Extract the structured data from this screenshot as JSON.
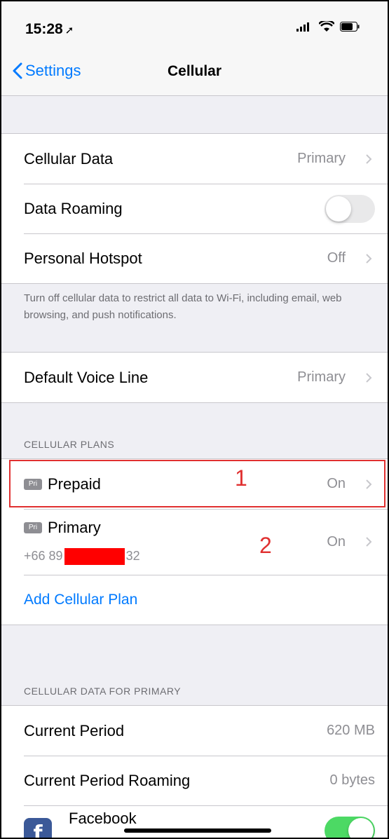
{
  "status": {
    "time": "15:28",
    "location_icon": "location-arrow-icon",
    "signal_icon": "signal-icon",
    "wifi_icon": "wifi-icon",
    "battery_icon": "battery-icon"
  },
  "nav": {
    "back_label": "Settings",
    "title": "Cellular"
  },
  "group1": {
    "cellular_data": {
      "label": "Cellular Data",
      "value": "Primary"
    },
    "data_roaming": {
      "label": "Data Roaming",
      "toggle_on": false
    },
    "personal_hotspot": {
      "label": "Personal Hotspot",
      "value": "Off"
    }
  },
  "group1_footer": "Turn off cellular data to restrict all data to Wi-Fi, including email, web browsing, and push notifications.",
  "voice": {
    "label": "Default Voice Line",
    "value": "Primary"
  },
  "plans": {
    "header": "CELLULAR PLANS",
    "prepaid": {
      "badge": "Pri",
      "label": "Prepaid",
      "value": "On"
    },
    "primary": {
      "badge": "Pri",
      "label": "Primary",
      "phone_prefix": "+66 89",
      "phone_suffix": "32",
      "value": "On"
    },
    "add_plan": "Add Cellular Plan"
  },
  "annotations": {
    "one": "1",
    "two": "2"
  },
  "usage": {
    "header": "CELLULAR DATA FOR PRIMARY",
    "current_period": {
      "label": "Current Period",
      "value": "620 MB"
    },
    "current_roaming": {
      "label": "Current Period Roaming",
      "value": "0 bytes"
    },
    "facebook": {
      "label": "Facebook",
      "toggle_on": true,
      "icon": "facebook-icon"
    }
  },
  "colors": {
    "accent": "#007aff",
    "toggle_on": "#4cd964",
    "annotation": "#e03030",
    "redaction": "#ff0000"
  }
}
